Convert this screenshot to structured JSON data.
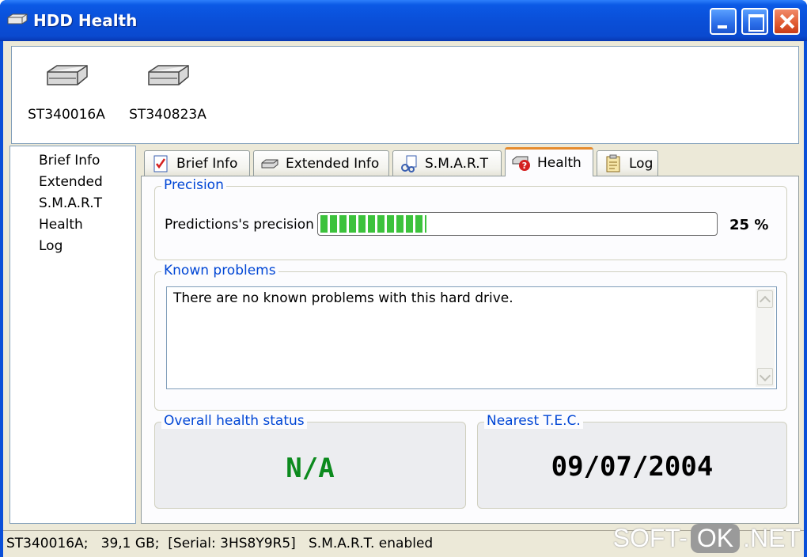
{
  "window": {
    "title": "HDD Health"
  },
  "drives": [
    {
      "label": "ST340016A",
      "icon": "hard-drive-icon"
    },
    {
      "label": "ST340823A",
      "icon": "hard-drive-icon"
    }
  ],
  "nav": {
    "items": [
      "Brief Info",
      "Extended",
      "S.M.A.R.T",
      "Health",
      "Log"
    ]
  },
  "tabs": [
    {
      "label": "Brief Info",
      "icon": "checklist-icon"
    },
    {
      "label": "Extended Info",
      "icon": "hard-drive-icon"
    },
    {
      "label": "S.M.A.R.T",
      "icon": "smart-tools-icon"
    },
    {
      "label": "Health",
      "icon": "health-warning-icon",
      "active": true
    },
    {
      "label": "Log",
      "icon": "log-icon"
    }
  ],
  "precision": {
    "group_label": "Precision",
    "label": "Predictions's precision",
    "value_text": "25 %",
    "fill_fraction": 0.27
  },
  "problems": {
    "group_label": "Known problems",
    "text": "There are no known problems with this hard drive."
  },
  "overall": {
    "group_label": "Overall health status",
    "value": "N/A"
  },
  "tec": {
    "group_label": "Nearest T.E.C.",
    "value": "09/07/2004"
  },
  "statusbar": {
    "text": "ST340016A;   39,1 GB;  [Serial: 3HS8Y9R5]   S.M.A.R.T. enabled"
  },
  "watermark": {
    "left": "SOFT-",
    "mid": "OK",
    "right": ".NET"
  },
  "colors": {
    "accent_label": "#0046d5",
    "status_ok": "#0c8a1e",
    "progress_green": "#3cc23c",
    "active_tab": "#e68b2c"
  }
}
